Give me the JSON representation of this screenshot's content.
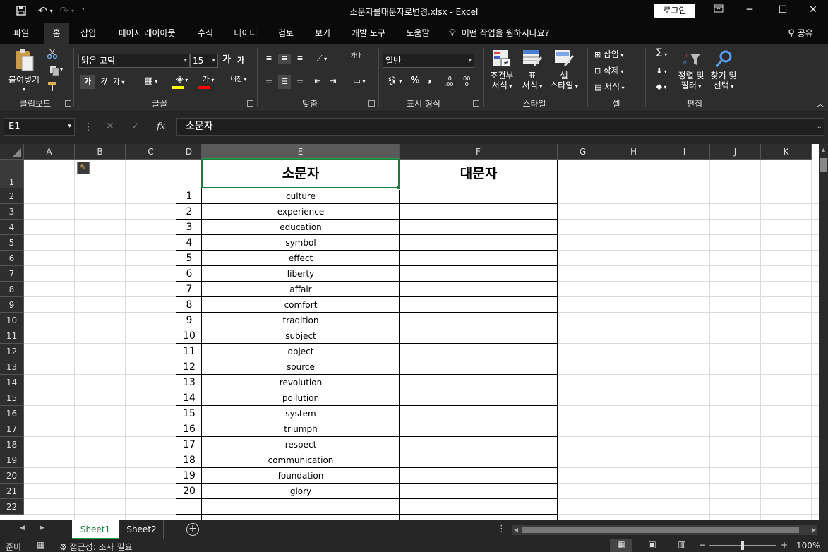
{
  "window": {
    "title": "소문자를대문자로변경.xlsx  -  Excel",
    "login_label": "로그인",
    "save_icon": "save-icon",
    "undo_icon": "undo-icon",
    "redo_icon": "redo-icon",
    "restore_icon": "ribbon-display-icon",
    "minimize_symbol": "─",
    "maximize_symbol": "☐",
    "close_symbol": "✕"
  },
  "menu": {
    "items": [
      "파일",
      "홈",
      "삽입",
      "페이지 레이아웃",
      "수식",
      "데이터",
      "검토",
      "보기",
      "개발 도구",
      "도움말"
    ],
    "active": "홈",
    "tell_me": "어떤 작업을 원하시나요?",
    "share": "공유"
  },
  "ribbon": {
    "clipboard": {
      "label": "클립보드",
      "paste": "붙여넣기"
    },
    "font": {
      "label": "글꼴",
      "name": "맑은 고딕",
      "size": "15",
      "bold": "가",
      "italic": "가",
      "underline": "가",
      "grow": "가",
      "shrink": "가",
      "phonetic": "내천",
      "color_text": "가"
    },
    "alignment": {
      "label": "맞춤",
      "wrap": "가나"
    },
    "number": {
      "label": "표시 형식",
      "format": "일반",
      "percent": "%",
      "comma": ","
    },
    "styles": {
      "label": "스타일",
      "conditional": "조건부",
      "conditional2": "서식",
      "table": "표",
      "table2": "서식",
      "cell": "셀",
      "cell2": "스타일"
    },
    "cells": {
      "label": "셀",
      "insert": "삽입",
      "delete": "삭제",
      "format": "서식"
    },
    "editing": {
      "label": "편집",
      "sort": "정렬 및",
      "sort2": "필터",
      "find": "찾기 및",
      "find2": "선택"
    }
  },
  "formula_bar": {
    "name_box": "E1",
    "fx": "fx",
    "content": "소문자"
  },
  "sheet": {
    "columns": [
      "A",
      "B",
      "C",
      "D",
      "E",
      "F",
      "G",
      "H",
      "I",
      "J",
      "K"
    ],
    "selected_column": "E",
    "header_lower": "소문자",
    "header_upper": "대문자",
    "row_numbers": [
      "1",
      "2",
      "3",
      "4",
      "5",
      "6",
      "7",
      "8",
      "9",
      "10",
      "11",
      "12",
      "13",
      "14",
      "15",
      "16",
      "17",
      "18",
      "19",
      "20",
      "21",
      "22"
    ],
    "index_values": [
      "1",
      "2",
      "3",
      "4",
      "5",
      "6",
      "7",
      "8",
      "9",
      "10",
      "11",
      "12",
      "13",
      "14",
      "15",
      "16",
      "17",
      "18",
      "19",
      "20"
    ],
    "words": [
      "culture",
      "experience",
      "education",
      "symbol",
      "effect",
      "liberty",
      "affair",
      "comfort",
      "tradition",
      "subject",
      "object",
      "source",
      "revolution",
      "pollution",
      "system",
      "triumph",
      "respect",
      "communication",
      "foundation",
      "glory"
    ]
  },
  "tabs": {
    "items": [
      "Sheet1",
      "Sheet2"
    ],
    "active": "Sheet1",
    "add": "+"
  },
  "status": {
    "ready": "준비",
    "accessibility": "접근성: 조사 필요",
    "zoom": "100%",
    "minus": "−",
    "plus": "+"
  },
  "colors": {
    "accent_green": "#1e9b4d",
    "dark_bg": "#262626",
    "ribbon_bg": "#2d2d2d"
  }
}
